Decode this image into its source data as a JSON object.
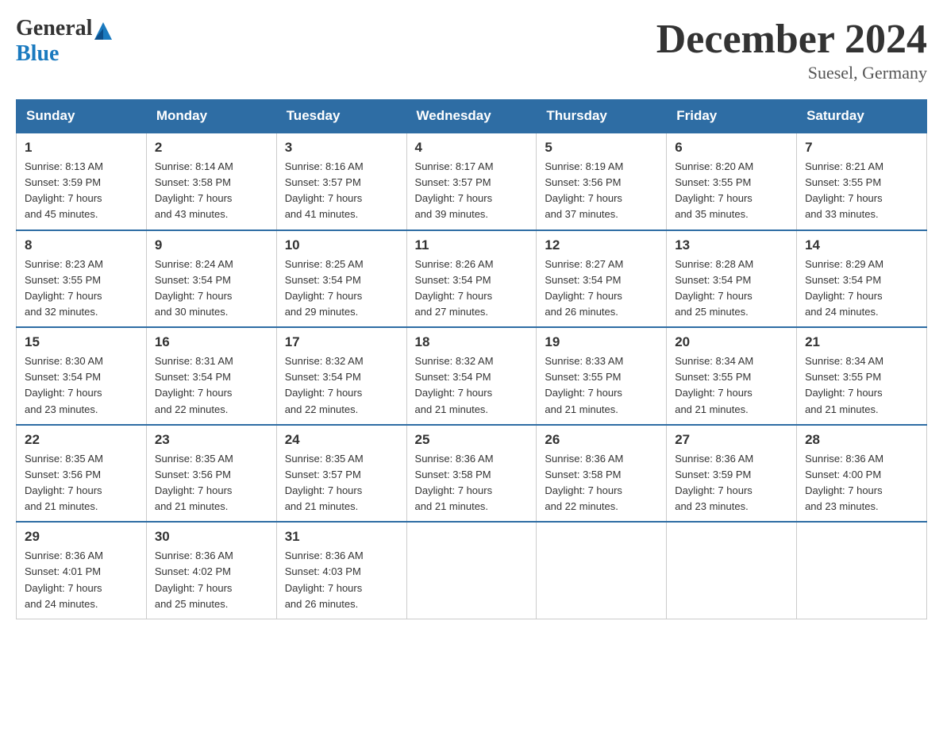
{
  "logo": {
    "general": "General",
    "blue": "Blue"
  },
  "title": {
    "month_year": "December 2024",
    "location": "Suesel, Germany"
  },
  "weekdays": [
    "Sunday",
    "Monday",
    "Tuesday",
    "Wednesday",
    "Thursday",
    "Friday",
    "Saturday"
  ],
  "weeks": [
    [
      {
        "day": "1",
        "sunrise": "8:13 AM",
        "sunset": "3:59 PM",
        "daylight": "7 hours and 45 minutes."
      },
      {
        "day": "2",
        "sunrise": "8:14 AM",
        "sunset": "3:58 PM",
        "daylight": "7 hours and 43 minutes."
      },
      {
        "day": "3",
        "sunrise": "8:16 AM",
        "sunset": "3:57 PM",
        "daylight": "7 hours and 41 minutes."
      },
      {
        "day": "4",
        "sunrise": "8:17 AM",
        "sunset": "3:57 PM",
        "daylight": "7 hours and 39 minutes."
      },
      {
        "day": "5",
        "sunrise": "8:19 AM",
        "sunset": "3:56 PM",
        "daylight": "7 hours and 37 minutes."
      },
      {
        "day": "6",
        "sunrise": "8:20 AM",
        "sunset": "3:55 PM",
        "daylight": "7 hours and 35 minutes."
      },
      {
        "day": "7",
        "sunrise": "8:21 AM",
        "sunset": "3:55 PM",
        "daylight": "7 hours and 33 minutes."
      }
    ],
    [
      {
        "day": "8",
        "sunrise": "8:23 AM",
        "sunset": "3:55 PM",
        "daylight": "7 hours and 32 minutes."
      },
      {
        "day": "9",
        "sunrise": "8:24 AM",
        "sunset": "3:54 PM",
        "daylight": "7 hours and 30 minutes."
      },
      {
        "day": "10",
        "sunrise": "8:25 AM",
        "sunset": "3:54 PM",
        "daylight": "7 hours and 29 minutes."
      },
      {
        "day": "11",
        "sunrise": "8:26 AM",
        "sunset": "3:54 PM",
        "daylight": "7 hours and 27 minutes."
      },
      {
        "day": "12",
        "sunrise": "8:27 AM",
        "sunset": "3:54 PM",
        "daylight": "7 hours and 26 minutes."
      },
      {
        "day": "13",
        "sunrise": "8:28 AM",
        "sunset": "3:54 PM",
        "daylight": "7 hours and 25 minutes."
      },
      {
        "day": "14",
        "sunrise": "8:29 AM",
        "sunset": "3:54 PM",
        "daylight": "7 hours and 24 minutes."
      }
    ],
    [
      {
        "day": "15",
        "sunrise": "8:30 AM",
        "sunset": "3:54 PM",
        "daylight": "7 hours and 23 minutes."
      },
      {
        "day": "16",
        "sunrise": "8:31 AM",
        "sunset": "3:54 PM",
        "daylight": "7 hours and 22 minutes."
      },
      {
        "day": "17",
        "sunrise": "8:32 AM",
        "sunset": "3:54 PM",
        "daylight": "7 hours and 22 minutes."
      },
      {
        "day": "18",
        "sunrise": "8:32 AM",
        "sunset": "3:54 PM",
        "daylight": "7 hours and 21 minutes."
      },
      {
        "day": "19",
        "sunrise": "8:33 AM",
        "sunset": "3:55 PM",
        "daylight": "7 hours and 21 minutes."
      },
      {
        "day": "20",
        "sunrise": "8:34 AM",
        "sunset": "3:55 PM",
        "daylight": "7 hours and 21 minutes."
      },
      {
        "day": "21",
        "sunrise": "8:34 AM",
        "sunset": "3:55 PM",
        "daylight": "7 hours and 21 minutes."
      }
    ],
    [
      {
        "day": "22",
        "sunrise": "8:35 AM",
        "sunset": "3:56 PM",
        "daylight": "7 hours and 21 minutes."
      },
      {
        "day": "23",
        "sunrise": "8:35 AM",
        "sunset": "3:56 PM",
        "daylight": "7 hours and 21 minutes."
      },
      {
        "day": "24",
        "sunrise": "8:35 AM",
        "sunset": "3:57 PM",
        "daylight": "7 hours and 21 minutes."
      },
      {
        "day": "25",
        "sunrise": "8:36 AM",
        "sunset": "3:58 PM",
        "daylight": "7 hours and 21 minutes."
      },
      {
        "day": "26",
        "sunrise": "8:36 AM",
        "sunset": "3:58 PM",
        "daylight": "7 hours and 22 minutes."
      },
      {
        "day": "27",
        "sunrise": "8:36 AM",
        "sunset": "3:59 PM",
        "daylight": "7 hours and 23 minutes."
      },
      {
        "day": "28",
        "sunrise": "8:36 AM",
        "sunset": "4:00 PM",
        "daylight": "7 hours and 23 minutes."
      }
    ],
    [
      {
        "day": "29",
        "sunrise": "8:36 AM",
        "sunset": "4:01 PM",
        "daylight": "7 hours and 24 minutes."
      },
      {
        "day": "30",
        "sunrise": "8:36 AM",
        "sunset": "4:02 PM",
        "daylight": "7 hours and 25 minutes."
      },
      {
        "day": "31",
        "sunrise": "8:36 AM",
        "sunset": "4:03 PM",
        "daylight": "7 hours and 26 minutes."
      },
      null,
      null,
      null,
      null
    ]
  ],
  "labels": {
    "sunrise": "Sunrise:",
    "sunset": "Sunset:",
    "daylight": "Daylight:"
  }
}
